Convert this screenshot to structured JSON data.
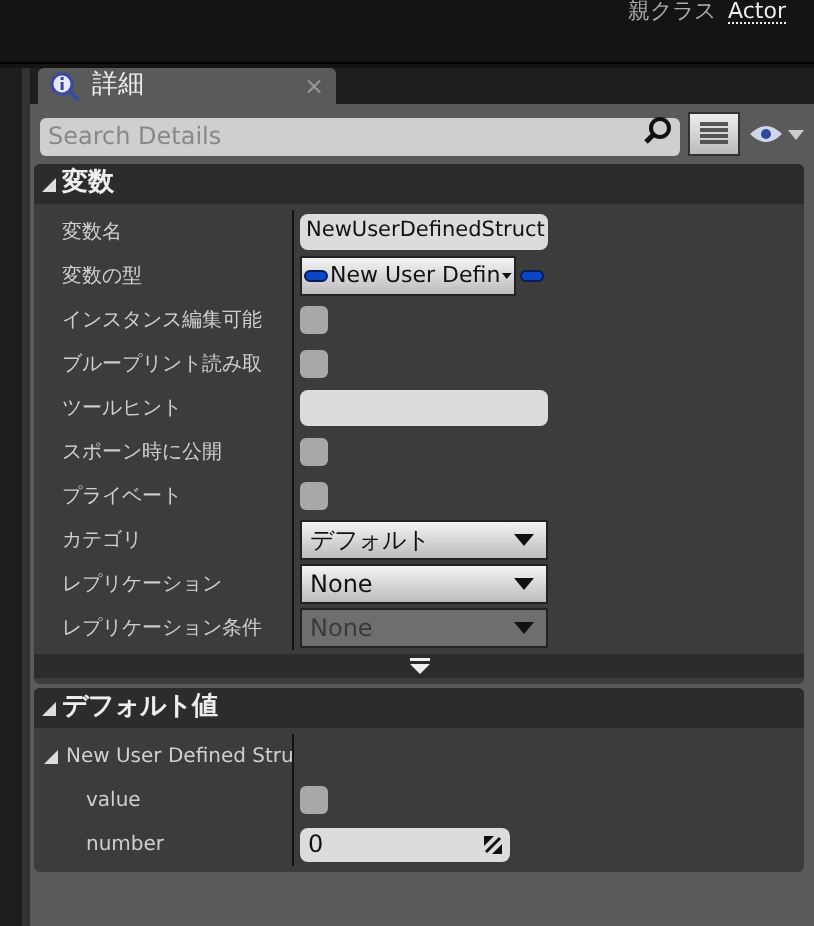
{
  "top_bar": {
    "label": "親クラス",
    "value": "Actor"
  },
  "tab": {
    "title": "詳細",
    "close": "×"
  },
  "search": {
    "placeholder": "Search Details"
  },
  "sections": [
    {
      "title": "変数",
      "expanded": true,
      "rows": [
        {
          "kind": "text",
          "label": "変数名",
          "value": "NewUserDefinedStruct"
        },
        {
          "kind": "type",
          "label": "変数の型",
          "value": "New User Defin"
        },
        {
          "kind": "checkbox",
          "label": "インスタンス編集可能",
          "checked": false
        },
        {
          "kind": "checkbox",
          "label": "ブループリント読み取",
          "checked": false
        },
        {
          "kind": "text",
          "label": "ツールヒント",
          "value": ""
        },
        {
          "kind": "checkbox",
          "label": "スポーン時に公開",
          "checked": false
        },
        {
          "kind": "checkbox",
          "label": "プライベート",
          "checked": false
        },
        {
          "kind": "dropdown",
          "label": "カテゴリ",
          "value": "デフォルト",
          "disabled": false
        },
        {
          "kind": "dropdown",
          "label": "レプリケーション",
          "value": "None",
          "disabled": false
        },
        {
          "kind": "dropdown",
          "label": "レプリケーション条件",
          "value": "None",
          "disabled": true
        }
      ],
      "more": true
    },
    {
      "title": "デフォルト値",
      "expanded": true,
      "rows": [
        {
          "kind": "group",
          "label": "New User Defined Stru",
          "expanded": true,
          "children": [
            {
              "kind": "checkbox",
              "label": "value",
              "checked": false
            },
            {
              "kind": "number",
              "label": "number",
              "value": "0"
            }
          ]
        }
      ]
    }
  ]
}
